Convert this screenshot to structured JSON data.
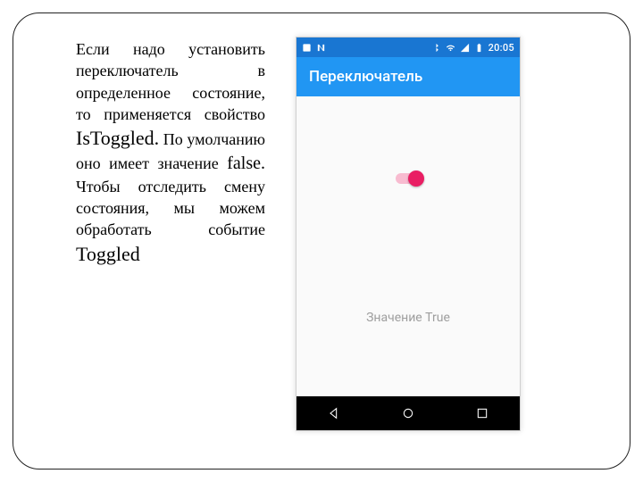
{
  "paragraph": {
    "p1": "Если надо установить переключатель в определенное состояние, то применяется свойство ",
    "istoggled": "IsToggled.",
    "p2": " По умолчанию оно имеет значение ",
    "false_word": "false.",
    "p3": " Чтобы отследить смену состояния, мы можем обработать событие ",
    "toggled_word": "Toggled"
  },
  "phone": {
    "statusbar": {
      "clock": "20:05"
    },
    "appbar": {
      "title": "Переключатель"
    },
    "value_label": "Значение True"
  }
}
